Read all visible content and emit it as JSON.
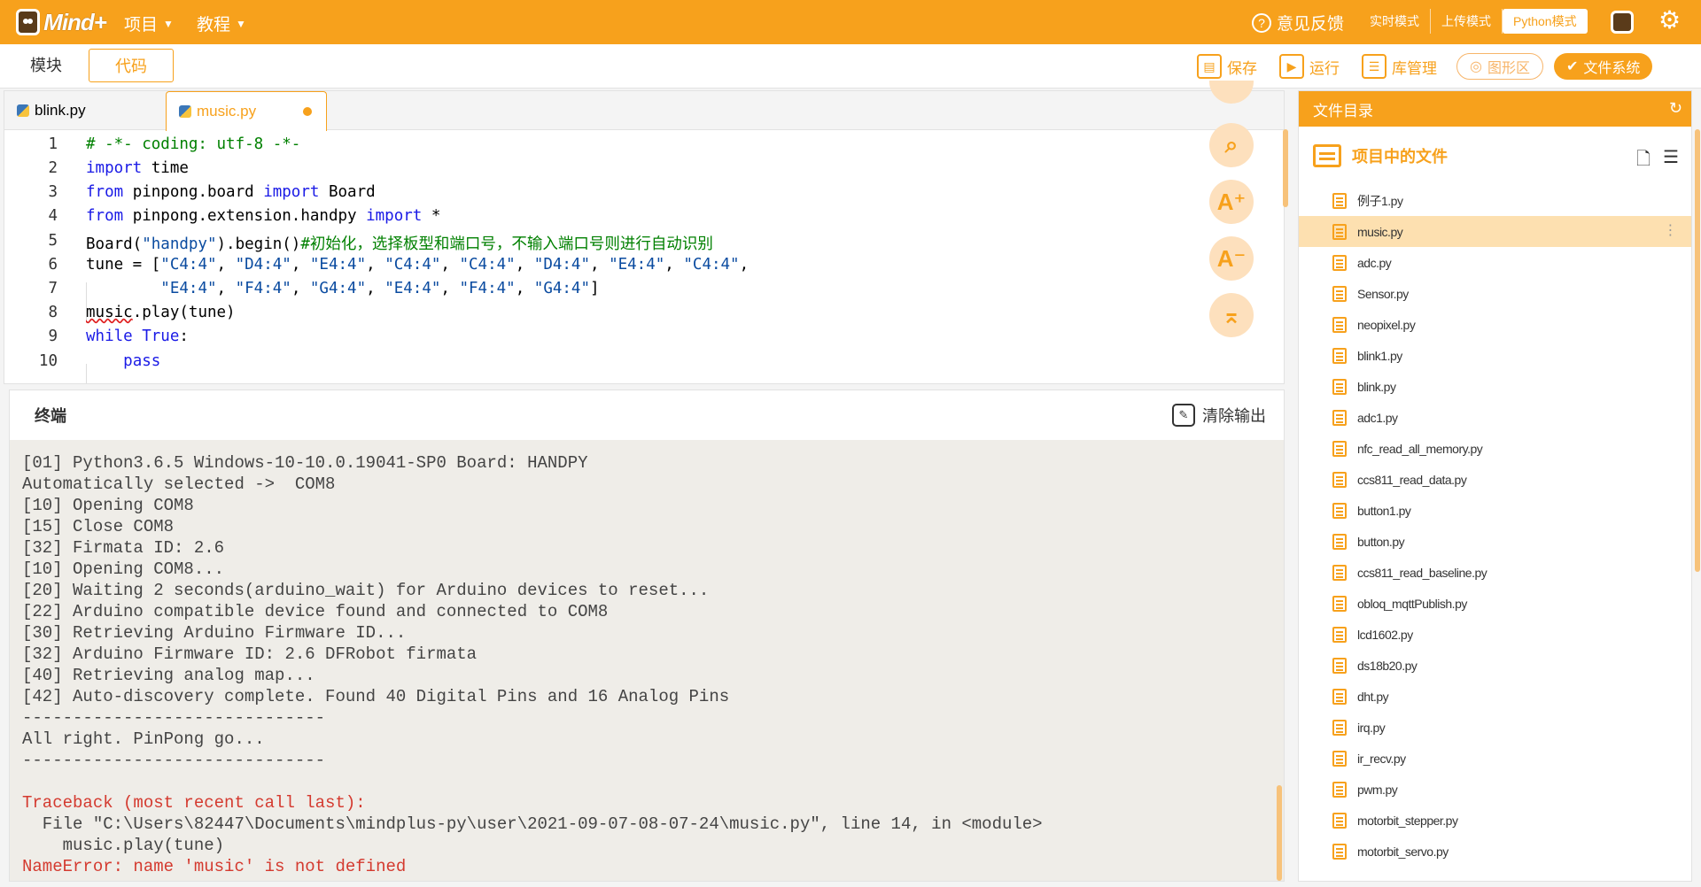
{
  "app": {
    "logo_text": "Mind+",
    "menu": [
      {
        "label": "项目"
      },
      {
        "label": "教程"
      }
    ],
    "feedback": "意见反馈",
    "modes": [
      "实时模式",
      "上传模式",
      "Python模式"
    ]
  },
  "toolbar": {
    "segments": [
      "模块",
      "代码"
    ],
    "save": "保存",
    "run": "运行",
    "libs": "库管理",
    "graphics": "图形区",
    "filesystem": "文件系统"
  },
  "editor": {
    "tabs": [
      {
        "label": "blink.py"
      },
      {
        "label": "music.py"
      }
    ],
    "line_numbers": [
      "1",
      "2",
      "3",
      "4",
      "5",
      "6",
      "7",
      "8",
      "9",
      "10"
    ]
  },
  "terminal": {
    "title": "终端",
    "clear": "清除输出",
    "lines": [
      "[01] Python3.6.5 Windows-10-10.0.19041-SP0 Board: HANDPY",
      "Automatically selected ->  COM8",
      "[10] Opening COM8",
      "[15] Close COM8",
      "[32] Firmata ID: 2.6",
      "[10] Opening COM8...",
      "[20] Waiting 2 seconds(arduino_wait) for Arduino devices to reset...",
      "[22] Arduino compatible device found and connected to COM8",
      "[30] Retrieving Arduino Firmware ID...",
      "[32] Arduino Firmware ID: 2.6 DFRobot firmata",
      "[40] Retrieving analog map...",
      "[42] Auto-discovery complete. Found 40 Digital Pins and 16 Analog Pins",
      "------------------------------",
      "All right. PinPong go...",
      "------------------------------",
      ""
    ],
    "error_lines": [
      "Traceback (most recent call last):",
      "  File \"C:\\Users\\82447\\Documents\\mindplus-py\\user\\2021-09-07-08-07-24\\music.py\", line 14, in <module>",
      "    music.play(tune)",
      "NameError: name 'music' is not defined"
    ]
  },
  "files": {
    "title": "文件目录",
    "project": "项目中的文件",
    "items": [
      "例子1.py",
      "music.py",
      "adc.py",
      "Sensor.py",
      "neopixel.py",
      "blink1.py",
      "blink.py",
      "adc1.py",
      "nfc_read_all_memory.py",
      "ccs811_read_data.py",
      "button1.py",
      "button.py",
      "ccs811_read_baseline.py",
      "obloq_mqttPublish.py",
      "lcd1602.py",
      "ds18b20.py",
      "dht.py",
      "irq.py",
      "ir_recv.py",
      "pwm.py",
      "motorbit_stepper.py",
      "motorbit_servo.py"
    ],
    "selected": "music.py"
  }
}
